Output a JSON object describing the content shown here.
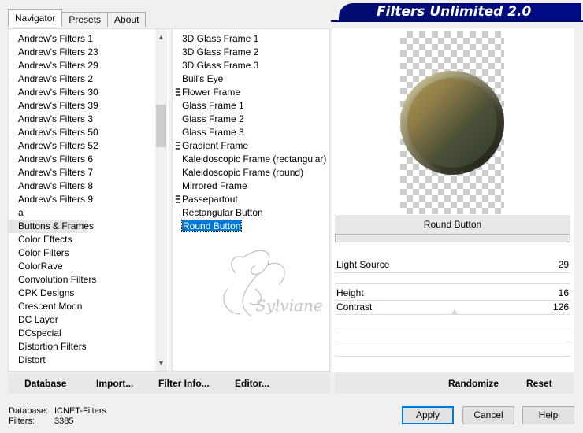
{
  "tabs": [
    {
      "label": "Navigator",
      "active": true
    },
    {
      "label": "Presets",
      "active": false
    },
    {
      "label": "About",
      "active": false
    }
  ],
  "banner": {
    "title": "Filters Unlimited 2.0"
  },
  "categories": [
    {
      "label": "Andrew's Filters 1"
    },
    {
      "label": "Andrew's Filters 23"
    },
    {
      "label": "Andrew's Filters 29"
    },
    {
      "label": "Andrew's Filters 2"
    },
    {
      "label": "Andrew's Filters 30"
    },
    {
      "label": "Andrew's Filters 39"
    },
    {
      "label": "Andrew's Filters 3"
    },
    {
      "label": "Andrew's Filters 50"
    },
    {
      "label": "Andrew's Filters 52"
    },
    {
      "label": "Andrew's Filters 6"
    },
    {
      "label": "Andrew's Filters 7"
    },
    {
      "label": "Andrew's Filters 8"
    },
    {
      "label": "Andrew's Filters 9"
    },
    {
      "label": "a"
    },
    {
      "label": "Buttons & Frames",
      "selected": true
    },
    {
      "label": "Color Effects"
    },
    {
      "label": "Color Filters"
    },
    {
      "label": "ColorRave"
    },
    {
      "label": "Convolution Filters"
    },
    {
      "label": "CPK Designs"
    },
    {
      "label": "Crescent Moon"
    },
    {
      "label": "DC Layer"
    },
    {
      "label": "DCspecial"
    },
    {
      "label": "Distortion Filters"
    },
    {
      "label": "Distort"
    }
  ],
  "filters": [
    {
      "label": "3D Glass Frame 1"
    },
    {
      "label": "3D Glass Frame 2"
    },
    {
      "label": "3D Glass Frame 3"
    },
    {
      "label": "Bull's Eye"
    },
    {
      "label": "Flower Frame",
      "grip": true
    },
    {
      "label": "Glass Frame 1"
    },
    {
      "label": "Glass Frame 2"
    },
    {
      "label": "Glass Frame 3"
    },
    {
      "label": "Gradient Frame",
      "grip": true
    },
    {
      "label": "Kaleidoscopic Frame (rectangular)"
    },
    {
      "label": "Kaleidoscopic Frame (round)"
    },
    {
      "label": "Mirrored Frame"
    },
    {
      "label": "Passepartout",
      "grip": true
    },
    {
      "label": "Rectangular Button"
    },
    {
      "label": "Round Button",
      "selected": true
    }
  ],
  "preview": {
    "filter_name": "Round Button"
  },
  "params": [
    {
      "label": "Light Source",
      "value": "29"
    },
    {
      "label": "Height",
      "value": "16"
    },
    {
      "label": "Contrast",
      "value": "126"
    }
  ],
  "watermark": {
    "text": "Sylviane"
  },
  "toolbar": {
    "database_label": "Database",
    "import_label": "Import...",
    "filter_info_label": "Filter Info...",
    "editor_label": "Editor...",
    "randomize_label": "Randomize",
    "reset_label": "Reset"
  },
  "status": {
    "database_label": "Database:",
    "database_value": "ICNET-Filters",
    "filters_label": "Filters:",
    "filters_value": "3385"
  },
  "buttons": {
    "apply": "Apply",
    "cancel": "Cancel",
    "help": "Help"
  },
  "colors": {
    "banner": "#000c6e",
    "selection": "#0078d7"
  }
}
